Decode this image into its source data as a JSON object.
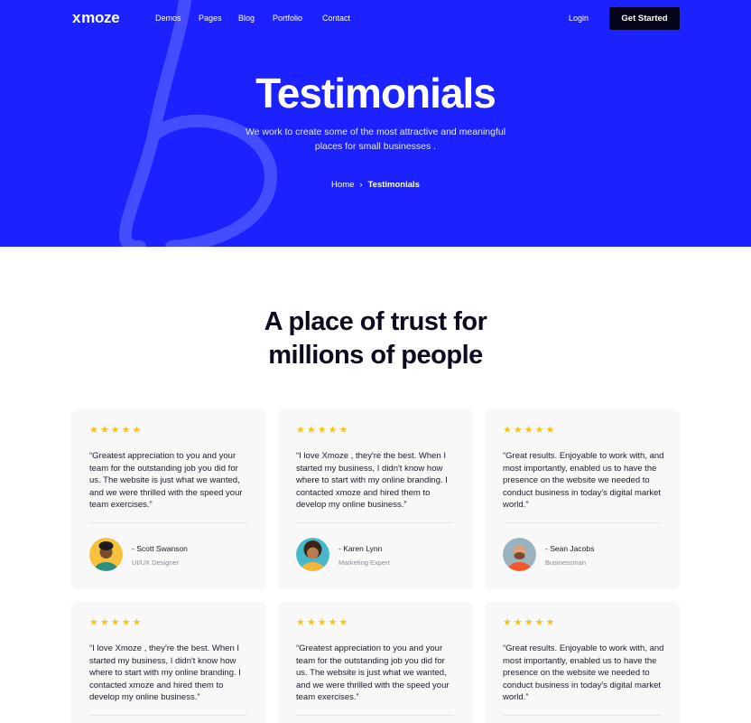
{
  "brand": {
    "logo": "moze",
    "logo_mark": "x"
  },
  "nav": {
    "items": [
      "Demos",
      "Pages",
      "Blog",
      "Portfolio",
      "Contact"
    ],
    "login": "Login",
    "cta": "Get Started"
  },
  "hero": {
    "title": "Testimonials",
    "subtitle": "We work to create some of the most attractive and meaningful places for small businesses .",
    "breadcrumb": {
      "home": "Home",
      "separator": "›",
      "current": "Testimonials"
    }
  },
  "section": {
    "title": "A place of trust for millions of people"
  },
  "testimonials": [
    {
      "rating": 5,
      "quote": "“Greatest appreciation to you and your team for the outstanding job you did for us. The website is just what we wanted, and we were thrilled with the speed your team exercises.”",
      "author": "- Scott Swanson",
      "role": "UI/UX Designer"
    },
    {
      "rating": 5,
      "quote": "“I love Xmoze , they're the best. When I started my business, I didn't know how where to start with my online branding. I contacted xmoze and hired them to develop my online business.”",
      "author": "- Karen Lynn",
      "role": "Marketing Expert"
    },
    {
      "rating": 5,
      "quote": "“Great results. Enjoyable to work with, and most importantly, enabled us to have the presence on the website we needed to conduct business in today's digital market world.”",
      "author": "- Sean Jacobs",
      "role": "Businessman"
    },
    {
      "rating": 5,
      "quote": "“I love Xmoze , they're the best. When I started my business, I didn't know how where to start with my online branding. I contacted xmoze and hired them to develop my online business.”",
      "author": "",
      "role": ""
    },
    {
      "rating": 5,
      "quote": "“Greatest appreciation to you and your team for the outstanding job you did for us. The website is just what we wanted, and we were thrilled with the speed your team exercises.”",
      "author": "",
      "role": ""
    },
    {
      "rating": 5,
      "quote": "“Great results. Enjoyable to work with, and most importantly, enabled us to have the presence on the website we needed to conduct business in today's digital market world.”",
      "author": "",
      "role": ""
    }
  ],
  "colors": {
    "hero_bg": "#1b22ff",
    "cta_bg": "#05051a",
    "star": "#f7c21a",
    "card_bg": "#f8f8f8"
  }
}
